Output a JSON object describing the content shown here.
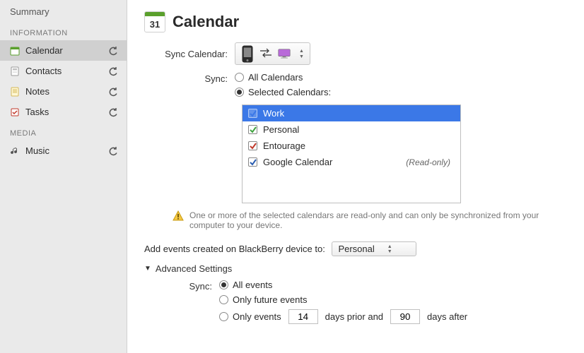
{
  "sidebar": {
    "summary_label": "Summary",
    "information_header": "INFORMATION",
    "media_header": "MEDIA",
    "info_items": [
      {
        "label": "Calendar"
      },
      {
        "label": "Contacts"
      },
      {
        "label": "Notes"
      },
      {
        "label": "Tasks"
      }
    ],
    "media_items": [
      {
        "label": "Music"
      }
    ]
  },
  "page": {
    "title": "Calendar",
    "icon_day": "31"
  },
  "sync_calendar": {
    "label": "Sync Calendar:"
  },
  "sync_scope": {
    "label": "Sync:",
    "options": {
      "all": "All Calendars",
      "selected": "Selected Calendars:"
    },
    "value": "selected"
  },
  "calendars": [
    {
      "name": "Work",
      "checked": true,
      "color": "#3b78e7",
      "selected": true,
      "readonly": false
    },
    {
      "name": "Personal",
      "checked": true,
      "color": "#3fa33f",
      "selected": false,
      "readonly": false
    },
    {
      "name": "Entourage",
      "checked": true,
      "color": "#c0392b",
      "selected": false,
      "readonly": false
    },
    {
      "name": "Google Calendar",
      "checked": true,
      "color": "#2a5db0",
      "selected": false,
      "readonly": true
    }
  ],
  "readonly_note": "(Read-only)",
  "warning_text": "One or more of the selected calendars are read-only and can only be synchronized from your computer to your device.",
  "add_events": {
    "label": "Add events created on BlackBerry device to:",
    "value": "Personal"
  },
  "advanced": {
    "header": "Advanced Settings",
    "sync_label": "Sync:",
    "options": {
      "all": "All events",
      "future": "Only future events",
      "range_prefix": "Only events",
      "range_mid": "days prior and",
      "range_suffix": "days after"
    },
    "value": "all",
    "days_prior": "14",
    "days_after": "90"
  }
}
